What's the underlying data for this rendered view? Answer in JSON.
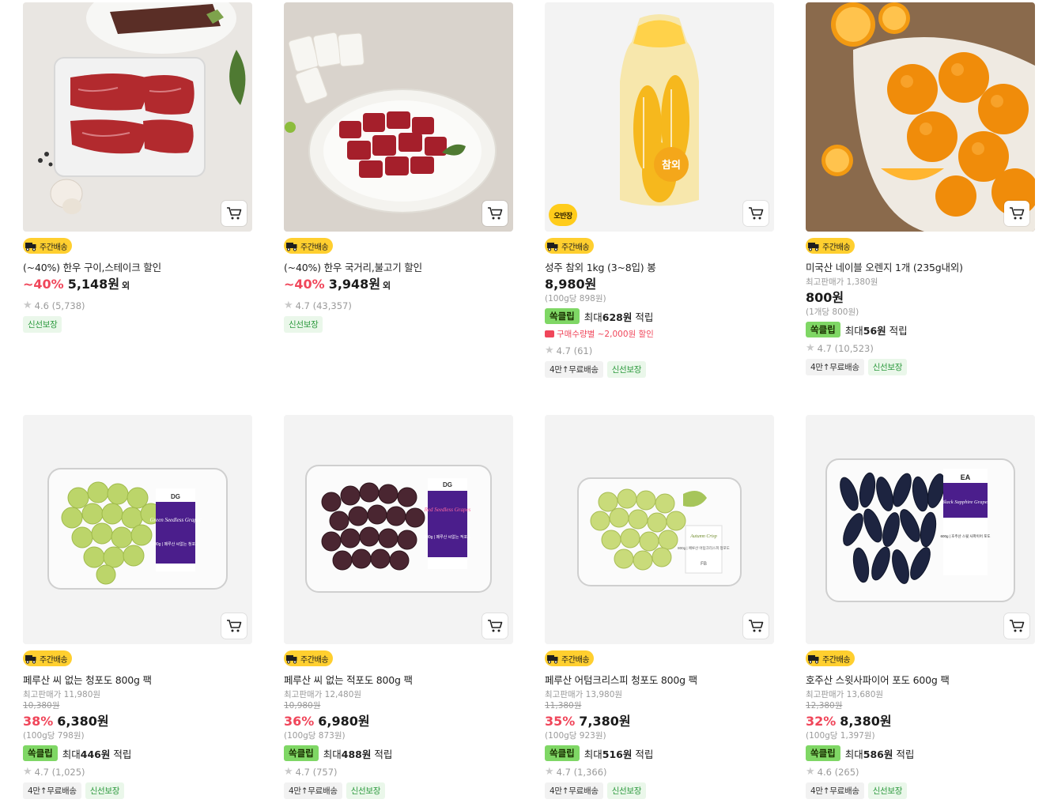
{
  "labels": {
    "ship": "주간배송",
    "point_tag": "쏙클립",
    "point_prefix": "최대",
    "point_suffix": "적립",
    "max_price_label": "최고판매가",
    "price_suffix_other": "외"
  },
  "products": [
    {
      "title": "(~40%) 한우 구이,스테이크 할인",
      "discount": "~40%",
      "price": "5,148원",
      "price_suffix": "외",
      "rating": "4.6",
      "reviews": "(5,738)",
      "tags": [
        "신선보장"
      ],
      "image": "beef-steak"
    },
    {
      "title": "(~40%) 한우 국거리,불고기 할인",
      "discount": "~40%",
      "price": "3,948원",
      "price_suffix": "외",
      "rating": "4.7",
      "reviews": "(43,357)",
      "tags": [
        "신선보장"
      ],
      "image": "beef-stew"
    },
    {
      "title": "성주 참외 1kg (3~8입) 봉",
      "price": "8,980원",
      "unit": "(100g당 898원)",
      "point": "628원",
      "promo": "구매수량별 ~2,000원 할인",
      "rating": "4.7",
      "reviews": "(61)",
      "tags": [
        "4만↑무료배송",
        "신선보장"
      ],
      "image": "melon-bag",
      "ohban": "오반장"
    },
    {
      "title": "미국산 네이블 오렌지 1개 (235g내외)",
      "max_price": "1,380원",
      "price": "800원",
      "unit": "(1개당 800원)",
      "point": "56원",
      "rating": "4.7",
      "reviews": "(10,523)",
      "tags": [
        "4만↑무료배송",
        "신선보장"
      ],
      "image": "oranges"
    },
    {
      "title": "페루산 씨 없는 청포도 800g 팩",
      "max_price": "11,980원",
      "orig_price": "10,380원",
      "discount": "38%",
      "price": "6,380원",
      "unit": "(100g당 798원)",
      "point": "446원",
      "rating": "4.7",
      "reviews": "(1,025)",
      "tags": [
        "4만↑무료배송",
        "신선보장"
      ],
      "image": "green-grapes"
    },
    {
      "title": "페루산 씨 없는 적포도 800g 팩",
      "max_price": "12,480원",
      "orig_price": "10,980원",
      "discount": "36%",
      "price": "6,980원",
      "unit": "(100g당 873원)",
      "point": "488원",
      "rating": "4.7",
      "reviews": "(757)",
      "tags": [
        "4만↑무료배송",
        "신선보장"
      ],
      "image": "red-grapes"
    },
    {
      "title": "페루산 어텀크리스피 청포도 800g 팩",
      "max_price": "13,980원",
      "orig_price": "11,380원",
      "discount": "35%",
      "price": "7,380원",
      "unit": "(100g당 923원)",
      "point": "516원",
      "rating": "4.7",
      "reviews": "(1,366)",
      "tags": [
        "4만↑무료배송",
        "신선보장"
      ],
      "image": "crisp-grapes"
    },
    {
      "title": "호주산 스윗사파이어 포도 600g 팩",
      "max_price": "13,680원",
      "orig_price": "12,380원",
      "discount": "32%",
      "price": "8,380원",
      "unit": "(100g당 1,397원)",
      "point": "586원",
      "rating": "4.6",
      "reviews": "(265)",
      "tags": [
        "4만↑무료배송",
        "신선보장"
      ],
      "image": "sapphire-grapes"
    }
  ],
  "pack_labels": {
    "green": {
      "brand": "DG",
      "script": "Green Seedless Grapes",
      "desc": "800g | 페루산 씨없는 청포도"
    },
    "red": {
      "brand": "DG",
      "script": "Red Seedless Grapes",
      "desc": "800g | 페루산 씨없는 적포도"
    },
    "crisp": {
      "script": "Autumn Crisp",
      "desc": "800g | 페루산 어텀크리스피 청포도",
      "code": "FB"
    },
    "sapphire": {
      "brand": "EA",
      "script": "Black Sapphire Grapes",
      "desc": "600g | 호주산 스윗 사파이어 포도"
    },
    "melon": "참외"
  },
  "colors": {
    "accent_red": "#f0465a",
    "ship_yellow": "#ffcf2f",
    "point_green": "#7fd765",
    "fresh_green": "#2d9a3e"
  }
}
